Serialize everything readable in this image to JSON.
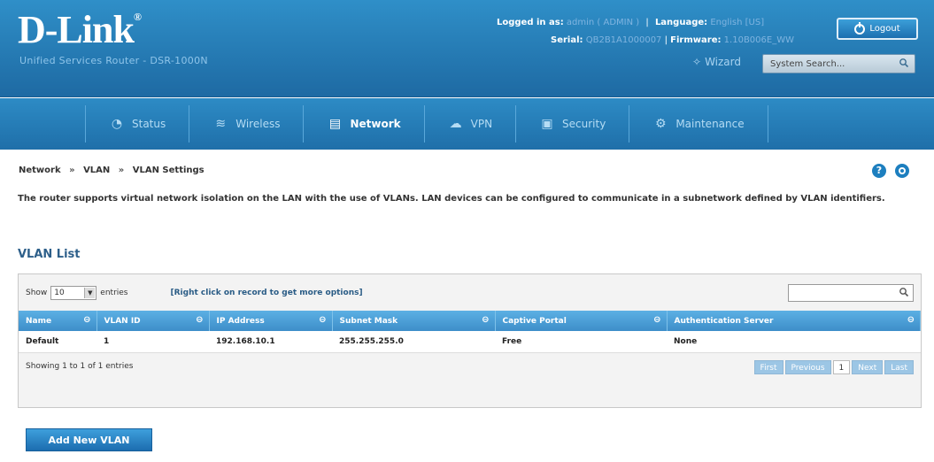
{
  "header": {
    "brand": "D-Link",
    "brand_mark": "®",
    "tagline": "Unified Services Router - DSR-1000N",
    "logged_in_label": "Logged in as:",
    "logged_in_user": "admin ( ADMIN )",
    "language_label": "Language:",
    "language_value": "English [US]",
    "serial_label": "Serial:",
    "serial_value": "QB2B1A1000007",
    "firmware_label": "Firmware:",
    "firmware_value": "1.10B006E_WW",
    "logout_label": "Logout",
    "wizard_label": "Wizard",
    "search_placeholder": "System Search..."
  },
  "nav": {
    "items": [
      {
        "label": "Status",
        "icon": "dashboard-icon"
      },
      {
        "label": "Wireless",
        "icon": "wifi-icon"
      },
      {
        "label": "Network",
        "icon": "network-icon",
        "active": true
      },
      {
        "label": "VPN",
        "icon": "cloud-icon"
      },
      {
        "label": "Security",
        "icon": "lock-icon"
      },
      {
        "label": "Maintenance",
        "icon": "gear-icon"
      }
    ]
  },
  "breadcrumb": {
    "items": [
      "Network",
      "VLAN",
      "VLAN Settings"
    ],
    "separator": "»"
  },
  "description": "The router supports virtual network isolation on the LAN with the use of VLANs. LAN devices can be configured to communicate in a subnetwork defined by VLAN identifiers.",
  "section_title": "VLAN List",
  "grid": {
    "show_label": "Show",
    "show_value": "10",
    "entries_label": "entries",
    "hint": "[Right click on record to get more options]",
    "columns": [
      "Name",
      "VLAN ID",
      "IP Address",
      "Subnet Mask",
      "Captive Portal",
      "Authentication Server"
    ],
    "rows": [
      [
        "Default",
        "1",
        "192.168.10.1",
        "255.255.255.0",
        "Free",
        "None"
      ]
    ],
    "footer": "Showing 1 to 1 of 1 entries",
    "pager": {
      "first": "First",
      "previous": "Previous",
      "current": "1",
      "next": "Next",
      "last": "Last"
    }
  },
  "add_button_label": "Add New VLAN"
}
